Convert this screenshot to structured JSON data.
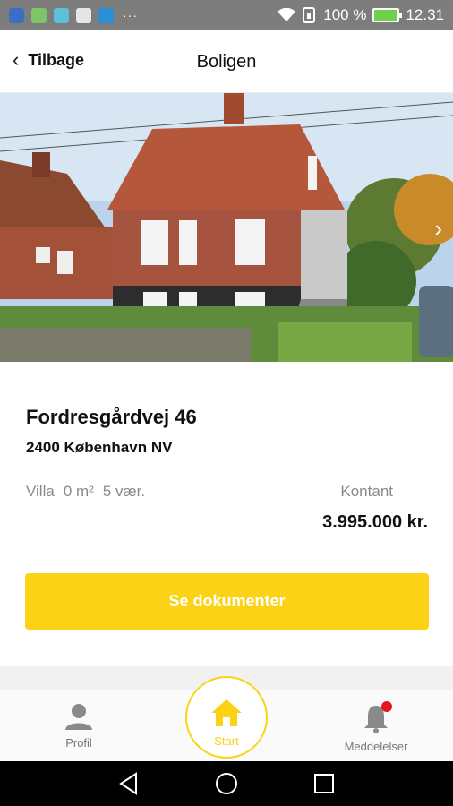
{
  "status_bar": {
    "battery": "100 %",
    "time": "12.31",
    "overflow": "···"
  },
  "header": {
    "back_label": "Tilbage",
    "title": "Boligen"
  },
  "property": {
    "street": "Fordresgårdvej 46",
    "city": "2400 København NV",
    "type": "Villa",
    "area": "0 m²",
    "rooms": "5 vær.",
    "price_label": "Kontant",
    "price": "3.995.000 kr.",
    "documents_button": "Se dokumenter"
  },
  "bottom_nav": {
    "profile": "Profil",
    "start": "Start",
    "messages": "Meddelelser"
  },
  "colors": {
    "accent": "#fcd216",
    "notification": "#e8141b",
    "status_bar": "#7d7d7d"
  }
}
